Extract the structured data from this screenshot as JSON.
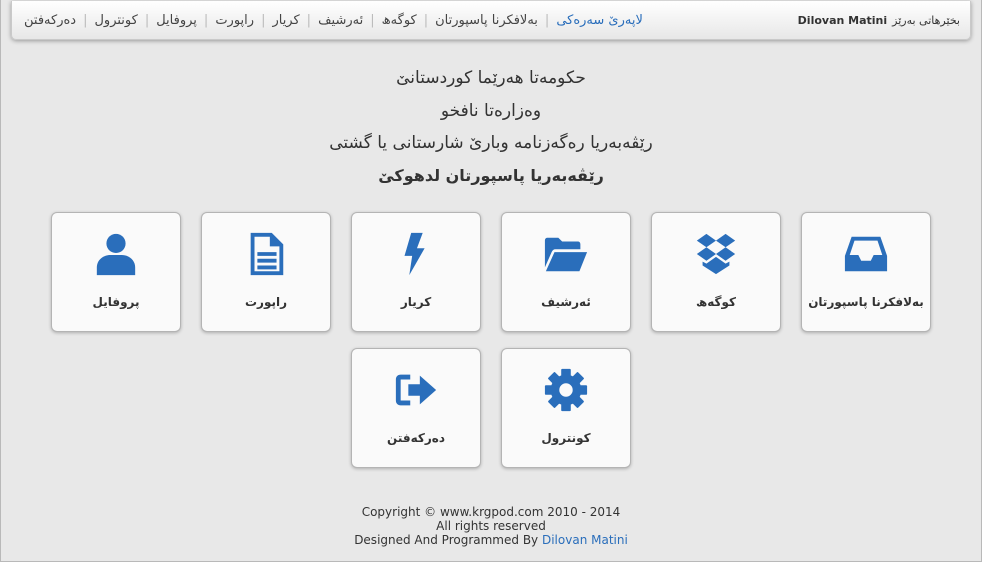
{
  "nav": {
    "welcome_prefix": "بخێرهاتی بەرێز",
    "user_name": "Dilovan Matini",
    "links": [
      {
        "label": "لاپەرێ سەرەکی",
        "active": true
      },
      {
        "label": "بەلافکرنا پاسپورتان"
      },
      {
        "label": "کوگەھ"
      },
      {
        "label": "ئەرشیف"
      },
      {
        "label": "کریار"
      },
      {
        "label": "راپورت"
      },
      {
        "label": "پروفایل"
      },
      {
        "label": "کونترول"
      },
      {
        "label": "دەرکەفتن"
      }
    ]
  },
  "header": {
    "line1": "حکومەتا هەرێما کوردستانێ",
    "line2": "وەزارەتا نافخو",
    "line3": "رێڤەبەریا رەگەزنامە وبارێ شارستانی یا گشتی",
    "line4": "رێڤەبەریا پاسپورتان لدهوکێ"
  },
  "tiles": {
    "passport": {
      "label": "بەلافکرنا پاسپورتان",
      "icon": "inbox-icon"
    },
    "store": {
      "label": "کوگەھ",
      "icon": "dropbox-icon"
    },
    "archive": {
      "label": "ئەرشیف",
      "icon": "folder-open-icon"
    },
    "customer": {
      "label": "کریار",
      "icon": "bolt-icon"
    },
    "report": {
      "label": "راپورت",
      "icon": "file-text-icon"
    },
    "profile": {
      "label": "پروفایل",
      "icon": "user-icon"
    },
    "control": {
      "label": "کونترول",
      "icon": "gear-icon"
    },
    "logout": {
      "label": "دەرکەفتن",
      "icon": "sign-out-icon"
    }
  },
  "footer": {
    "copyright": "Copyright © www.krgpod.com 2010 - 2014",
    "rights": "All rights reserved",
    "designed_prefix": "Designed And Programmed By",
    "designer": "Dilovan Matini"
  },
  "colors": {
    "accent": "#2a6ebb",
    "background": "#e8e8e8"
  }
}
